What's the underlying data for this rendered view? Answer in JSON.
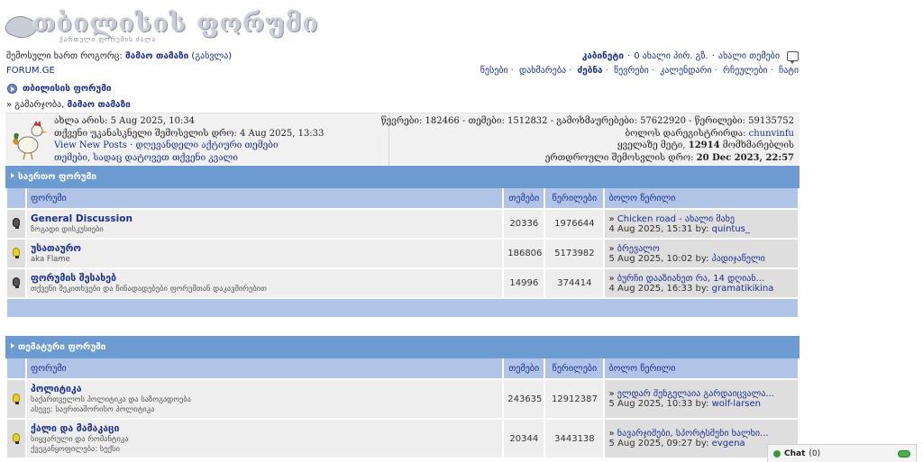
{
  "logo": {
    "title": "თბილისის ფორუმი",
    "subtitle": "ქართული ფორუმის ძალა"
  },
  "header": {
    "welcome_prefix": "შემოსული ხართ როგორც:",
    "user_name": "მამაო თამაზი",
    "logout_open": "(",
    "logout_label": "გასვლა",
    "logout_close": ")",
    "site_link": "FORUM.GE",
    "cabinet_label": "კაბინეტი",
    "pm_label": "0 ახალი პირ. გზ.",
    "new_topics_label": "ახალი თემები",
    "nav": [
      {
        "label": "წესები"
      },
      {
        "label": "დახმარება"
      },
      {
        "label": "ძებნა"
      },
      {
        "label": "წევრები"
      },
      {
        "label": "კალენდარი"
      },
      {
        "label": "რჩეულები"
      },
      {
        "label": "ჩატი"
      }
    ]
  },
  "breadcrumb": {
    "title": "თბილისის ფორუმი",
    "greeting_prefix": "» გამარჯობა,",
    "greeting_name": "მამაო თამაზი"
  },
  "info": {
    "left": {
      "now": "ახლა არის: 5 Aug 2025, 10:34",
      "last_visit": "თქვენი უკანასკნელი შემოსვლის დრო: 4 Aug 2025, 13:33",
      "view_new_posts": "View New Posts",
      "followed_topics": "დღევანდელი აქტიური თემები",
      "topics_you_posted": "თემები, სადაც დატოვეთ თქვენი კვალი"
    },
    "right": {
      "stats": "წევრები: 182466 - თემები: 1512832 - გამოხმაურებები: 57622920 - წერილები: 59135752",
      "last_registered_prefix": "ბოლოს დარეგისტრირდა:",
      "last_registered_user": "chunvinfu",
      "most_online_prefix": "ყველაზე მეტი,",
      "most_online_count": "12914",
      "most_online_suffix": "მომხმარებლის",
      "simultaneous_prefix": "ერთდროული შემოსვლის დრო:",
      "simultaneous_date": "20 Dec 2023, 22:57"
    }
  },
  "categories": [
    {
      "title": "საერთო ფორუმი",
      "columns": {
        "forum": "ფორუმი",
        "topics": "თემები",
        "posts": "წერილები",
        "last_post": "ბოლო წერილი"
      },
      "rows": [
        {
          "name": "General Discussion",
          "desc": "ზოგადი დისკუსიები",
          "topics": "20336",
          "posts": "1976644",
          "last_title": "Chicken road - ახალი მახე",
          "last_date": "4 Aug 2025, 15:31 by:",
          "last_user": "quintus_",
          "icon": "bulb-off-icon"
        },
        {
          "name": "უსათაურო",
          "desc": "aka Flame",
          "topics": "186806",
          "posts": "5173982",
          "last_title": "ბრევალო",
          "last_date": "5 Aug 2025, 10:02 by:",
          "last_user": "პადიჯაწელი",
          "icon": "bulb-on-icon"
        },
        {
          "name": "ფორუმის შესახებ",
          "desc": "თქვენი შეკითხვები და წინადადებები ფორუმთან დაკავშირებით",
          "topics": "14996",
          "posts": "374414",
          "last_title": "ბურჩი დააზიანეთ რა, 14 დღიან...",
          "last_date": "4 Aug 2025, 16:33 by:",
          "last_user": "gramatikikina",
          "icon": "bulb-off-icon"
        }
      ]
    },
    {
      "title": "თემატური ფორუმი",
      "columns": {
        "forum": "ფორუმი",
        "topics": "თემები",
        "posts": "წერილები",
        "last_post": "ბოლო წერილი"
      },
      "rows": [
        {
          "name": "პოლიტიკა",
          "desc": "საქართველოს პოლიტიკა და საზოგადოება",
          "desc2": "ასევე: საერთაშორისო პოლიტიკა",
          "topics": "243635",
          "posts": "12912387",
          "last_title": "ელდარ შენგელაია გარდაიცვალა...",
          "last_date": "5 Aug 2025, 10:33 by:",
          "last_user": "wolf-larsen",
          "icon": "bulb-on-icon"
        },
        {
          "name": "ქალი და მამაკაცი",
          "desc": "სიყვარული და რომანტიკა",
          "desc2": "ქვეგანყოფილება: სექსი",
          "topics": "20344",
          "posts": "3443138",
          "last_title": "ნავარჯიშები, სპორტსმენი ხალხი...",
          "last_date": "5 Aug 2025, 09:27 by:",
          "last_user": "evgena",
          "icon": "bulb-on-icon"
        }
      ]
    }
  ],
  "chat": {
    "label": "Chat",
    "count": "(0)"
  },
  "colors": {
    "link": "#1b2f8f",
    "category_header": "#6b9bd0",
    "column_header": "#afc4e6",
    "row_light": "#eeeeee",
    "row_dark": "#dedede"
  }
}
